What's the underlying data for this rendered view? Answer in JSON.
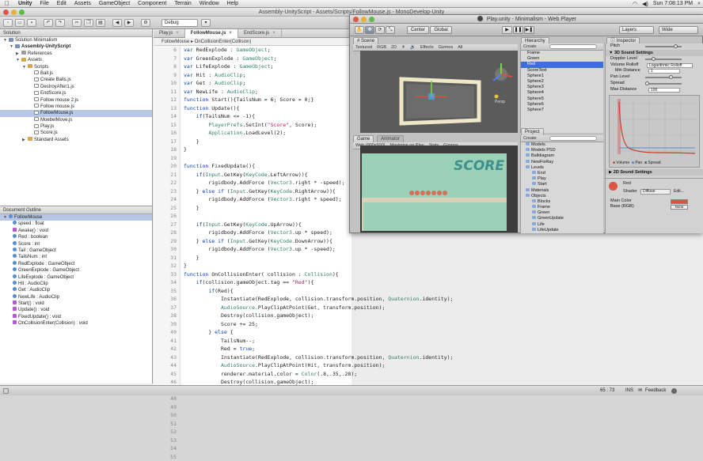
{
  "menubar": {
    "apple": "",
    "items": [
      "Unity",
      "File",
      "Edit",
      "Assets",
      "GameObject",
      "Component",
      "Terrain",
      "Window",
      "Help"
    ],
    "clock": "Sun 7:08:13 PM"
  },
  "monodevelop": {
    "title": "Assembly-UnityScript - Assets/Scripts/FollowMouse.js - MonoDevelop-Unity",
    "config": "Debug",
    "solution_header": "Solution",
    "solution_tree": [
      {
        "label": "Solution Minimalism",
        "indent": 0,
        "icon": "sol",
        "arrow": "▼"
      },
      {
        "label": "Assembly-UnityScript",
        "indent": 1,
        "icon": "sol",
        "arrow": "▼",
        "bold": true
      },
      {
        "label": "References",
        "indent": 2,
        "icon": "ref",
        "arrow": "▶"
      },
      {
        "label": "Assets",
        "indent": 2,
        "icon": "folder",
        "arrow": "▼"
      },
      {
        "label": "Scripts",
        "indent": 3,
        "icon": "folder",
        "arrow": "▼"
      },
      {
        "label": "Ball.js",
        "indent": 4,
        "icon": "js"
      },
      {
        "label": "Create Balls.js",
        "indent": 4,
        "icon": "js"
      },
      {
        "label": "DestroyAfter1.js",
        "indent": 4,
        "icon": "js"
      },
      {
        "label": "EndScore.js",
        "indent": 4,
        "icon": "js"
      },
      {
        "label": "Follow mouse 2.js",
        "indent": 4,
        "icon": "js"
      },
      {
        "label": "Follow mouse.js",
        "indent": 4,
        "icon": "js"
      },
      {
        "label": "FollowMouse.js",
        "indent": 4,
        "icon": "js",
        "selected": true
      },
      {
        "label": "MoebelMove.js",
        "indent": 4,
        "icon": "js"
      },
      {
        "label": "Play.js",
        "indent": 4,
        "icon": "js"
      },
      {
        "label": "Score.js",
        "indent": 4,
        "icon": "js"
      },
      {
        "label": "Standard Assets",
        "indent": 3,
        "icon": "folder",
        "arrow": "▶"
      }
    ],
    "outline_header": "Document Outline",
    "outline": [
      {
        "label": "FollowMouse",
        "kind": "class",
        "selected": true
      },
      {
        "label": "speed : float",
        "kind": "f"
      },
      {
        "label": "Awake() : void",
        "kind": "m"
      },
      {
        "label": "Red : boolean",
        "kind": "f"
      },
      {
        "label": "Score : int",
        "kind": "f"
      },
      {
        "label": "Tail : GameObject",
        "kind": "f"
      },
      {
        "label": "TailsNum : int",
        "kind": "f"
      },
      {
        "label": "RedExplode : GameObject",
        "kind": "f"
      },
      {
        "label": "GreenExplode : GameObject",
        "kind": "f"
      },
      {
        "label": "LifeExplode : GameObject",
        "kind": "f"
      },
      {
        "label": "Hit : AudioClip",
        "kind": "f"
      },
      {
        "label": "Get : AudioClip",
        "kind": "f"
      },
      {
        "label": "NewLife : AudioClip",
        "kind": "f"
      },
      {
        "label": "Start() : void",
        "kind": "m"
      },
      {
        "label": "Update() : void",
        "kind": "m"
      },
      {
        "label": "FixedUpdate() : void",
        "kind": "m"
      },
      {
        "label": "OnCollisionEnter(Collision) : void",
        "kind": "m"
      }
    ],
    "tabs": [
      "Play.js",
      "FollowMouse.js",
      "EndScore.js"
    ],
    "active_tab": 1,
    "breadcrumb": "FollowMouse ▸ OnCollisionEnter(Collision)",
    "first_line": 6,
    "code_lines": [
      "var RedExplode : GameObject;",
      "var GreenExplode : GameObject;",
      "var LifeExplode : GameObject;",
      "var Hit : AudioClip;",
      "var Get : AudioClip;",
      "var NewLife : AudioClip;",
      "function Start(){TailsNum = 6; Score = 0;}",
      "function Update(){",
      "    if(TailsNum <= -1){",
      "        PlayerPrefs.SetInt(\"Score\", Score);",
      "        Application.LoadLevel(2);",
      "    }",
      "}",
      "",
      "function FixedUpdate(){",
      "    if(Input.GetKey(KeyCode.LeftArrow)){",
      "        rigidbody.AddForce (Vector3.right * -speed);",
      "    } else if (Input.GetKey(KeyCode.RightArrow)){",
      "        rigidbody.AddForce (Vector3.right * speed);",
      "    }",
      "",
      "    if(Input.GetKey(KeyCode.UpArrow)){",
      "        rigidbody.AddForce (Vector3.up * speed);",
      "    } else if (Input.GetKey(KeyCode.DownArrow)){",
      "        rigidbody.AddForce (Vector3.up * -speed);",
      "    }",
      "}",
      "function OnCollisionEnter( collision : Collision){",
      "    if(collision.gameObject.tag == \"Red\"){",
      "        if(Red){",
      "            Instantiate(RedExplode, collision.transform.position, Quaternion.identity);",
      "            AudioSource.PlayClipAtPoint(Get, transform.position);",
      "            Destroy(collision.gameObject);",
      "            Score += 25;",
      "        } else {",
      "            TailsNum--;",
      "            Red = true;",
      "            Instantiate(RedExplode, collision.transform.position, Quaternion.identity);",
      "            AudioSource.PlayClipAtPoint(Hit, transform.position);",
      "            renderer.material.color = Color(.8,.35,.28);",
      "            Destroy(collision.gameObject);",
      "            Tail[TailsNum].GetComponent(MeshRenderer).enabled = false;",
      "            Tail[TailsNum].GetComponent(SphereCollider).enabled = false;",
      "            Debug.Log(TailsNum);",
      "        }",
      "",
      "    } else if (collision.gameObject.tag == \"Green\"){",
      "        if(!Red){",
      "            Instantiate(GreenExplode, collision.transform.position, Quaternion.identity);",
      "            AudioSource.PlayClipAtPoint(Get, transform.position);"
    ],
    "status": {
      "position": "65 : 73",
      "mode": "INS",
      "feedback": "Feedback"
    }
  },
  "unity": {
    "title": "Play.unity - Minimalism - Web Player",
    "toolbar": {
      "center": "Center",
      "global": "Global",
      "layers": "Layers",
      "layout": "Wide"
    },
    "scene_tab": "Scene",
    "scene_bar": [
      "Textured",
      "RGB",
      "2D",
      "☀",
      "🔊",
      "Effects",
      "Gizmos",
      "All"
    ],
    "scene_persp": "Persp",
    "game_tab": "Game",
    "animator_tab": "Animator",
    "game_bar": [
      "Web (900x500)",
      "Maximize on Play",
      "Stats",
      "Gizmos"
    ],
    "score_text": "SCORE",
    "hierarchy_tab": "Hierarchy",
    "hierarchy_create": "Create",
    "hierarchy": [
      {
        "label": "Frame"
      },
      {
        "label": "Green"
      },
      {
        "label": "Red",
        "selected": true
      },
      {
        "label": "ScoreText"
      },
      {
        "label": "Sphere1"
      },
      {
        "label": "Sphere2"
      },
      {
        "label": "Sphere3"
      },
      {
        "label": "Sphere4"
      },
      {
        "label": "Sphere5"
      },
      {
        "label": "Sphere6"
      },
      {
        "label": "Sphere7"
      }
    ],
    "project_tab": "Project",
    "project_create": "Create",
    "project": [
      {
        "label": "Models",
        "indent": 0
      },
      {
        "label": "Models PSD",
        "indent": 0
      },
      {
        "label": "Balldiagram",
        "indent": 0
      },
      {
        "label": "NewFixRay",
        "indent": 0
      },
      {
        "label": "Levels",
        "indent": 0
      },
      {
        "label": "End",
        "indent": 1
      },
      {
        "label": "Play",
        "indent": 1
      },
      {
        "label": "Start",
        "indent": 1
      },
      {
        "label": "Materials",
        "indent": 0
      },
      {
        "label": "Objects",
        "indent": 0
      },
      {
        "label": "Blocks",
        "indent": 1
      },
      {
        "label": "Frame",
        "indent": 1
      },
      {
        "label": "Green",
        "indent": 1
      },
      {
        "label": "GreenUpdate",
        "indent": 1
      },
      {
        "label": "Life",
        "indent": 1
      },
      {
        "label": "LifeUpdate",
        "indent": 1
      }
    ],
    "inspector_tab": "Inspector",
    "inspector": {
      "pitch_label": "Pitch",
      "section_3d": "3D Sound Settings",
      "doppler_label": "Doppler Level",
      "rolloff_label": "Volume Rolloff",
      "rolloff_value": "Logarithmic Rolloff",
      "min_label": "Min Distance",
      "min_value": "1",
      "pan_label": "Pan Level",
      "spread_label": "Spread",
      "spread_value": "0",
      "max_label": "Max Distance",
      "max_value": "100",
      "graph_legend": [
        "Volume",
        "Pan",
        "Spread"
      ],
      "section_2d": "2D Sound Settings",
      "material_name": "Red",
      "shader_label": "Shader",
      "shader_value": "Diffuse",
      "edit_label": "Edit...",
      "main_color_label": "Main Color",
      "base_label": "Base (RGB)",
      "none_label": "None"
    },
    "accent": "#3d6fd6",
    "red_material": "#d9553f"
  }
}
